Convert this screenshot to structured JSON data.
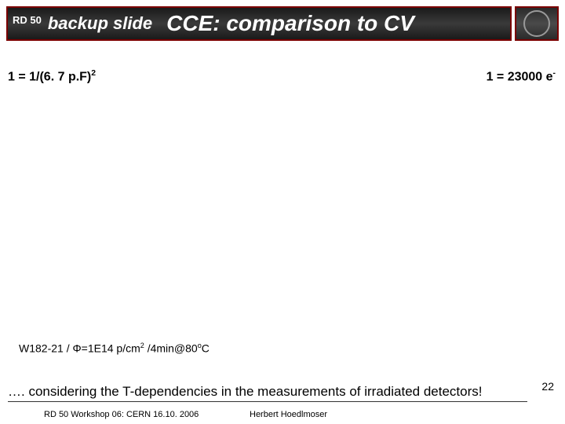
{
  "header": {
    "rd50": "RD 50",
    "backup": "backup slide",
    "title": "CCE: comparison to CV"
  },
  "left_eq_pre": "1 = 1/(6. 7 p.F)",
  "left_eq_sup": "2",
  "right_eq_pre": "1 = 23000 e",
  "right_eq_sup": "-",
  "sample_p1": "W182-21 / Φ=1E14 p/cm",
  "sample_sup1": "2",
  "sample_p2": " /4min@80",
  "sample_sup2": "o",
  "sample_p3": "C",
  "note": "…. considering the T-dependencies in the measurements of irradiated detectors!",
  "page_number": "22",
  "footer": {
    "left": "RD 50 Workshop 06: CERN 16.10. 2006",
    "center": "Herbert Hoedlmoser"
  }
}
